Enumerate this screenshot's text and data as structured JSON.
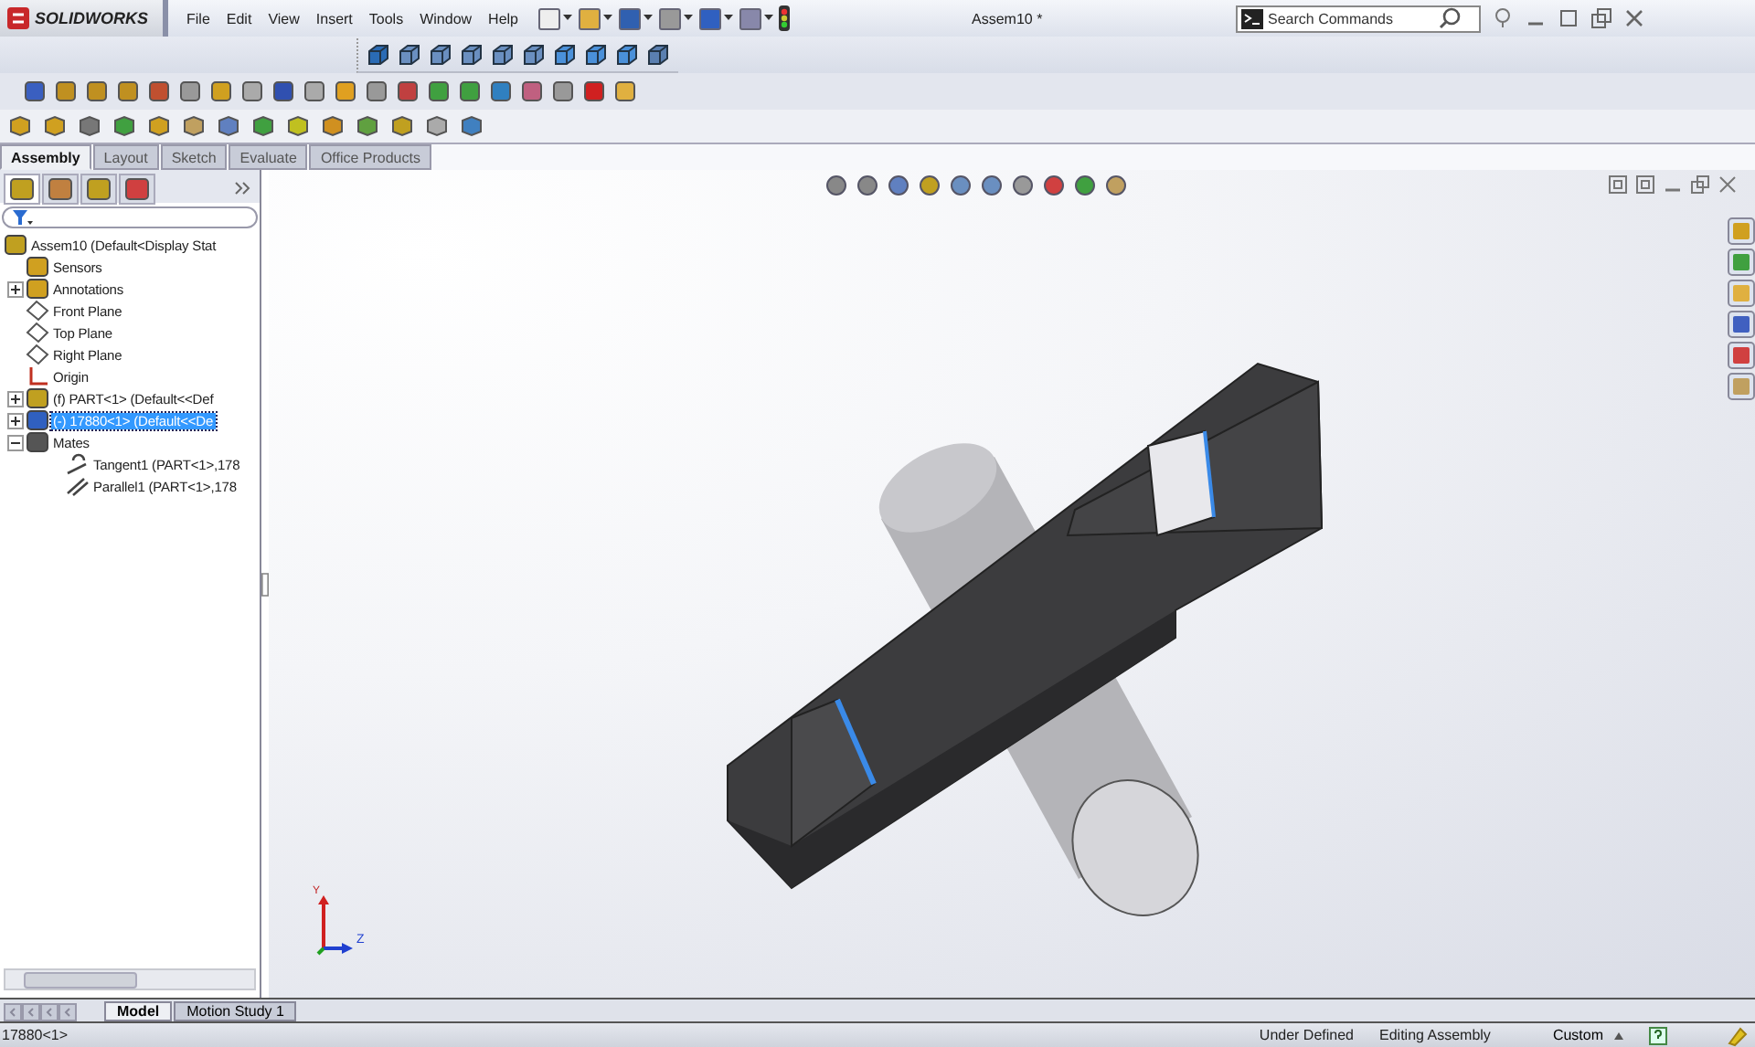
{
  "window": {
    "logo": "SOLIDWORKS",
    "title": "Assem10 *",
    "menus": [
      "File",
      "Edit",
      "View",
      "Insert",
      "Tools",
      "Window",
      "Help"
    ],
    "search": {
      "placeholder": "Search Commands"
    }
  },
  "command_tabs": [
    {
      "label": "Assembly",
      "selected": true
    },
    {
      "label": "Layout",
      "selected": false
    },
    {
      "label": "Sketch",
      "selected": false
    },
    {
      "label": "Evaluate",
      "selected": false
    },
    {
      "label": "Office Products",
      "selected": false
    }
  ],
  "feature_tree": {
    "root": {
      "label": "Assem10  (Default<Display Stat",
      "kind": "assembly",
      "selected": false,
      "children": [
        {
          "label": "Sensors",
          "kind": "sensor",
          "selected": false
        },
        {
          "label": "Annotations",
          "kind": "annotation",
          "selected": false,
          "expanded": false
        },
        {
          "label": "Front Plane",
          "kind": "plane",
          "selected": false
        },
        {
          "label": "Top Plane",
          "kind": "plane",
          "selected": false
        },
        {
          "label": "Right Plane",
          "kind": "plane",
          "selected": false
        },
        {
          "label": "Origin",
          "kind": "origin",
          "selected": false
        },
        {
          "label": "(f) PART<1> (Default<<Def",
          "kind": "part",
          "selected": false,
          "expanded": false
        },
        {
          "label": "(-) 17880<1> (Default<<De",
          "kind": "part-blue",
          "selected": true,
          "expanded": false
        },
        {
          "label": "Mates",
          "kind": "mates",
          "selected": false,
          "expanded": true,
          "children": [
            {
              "label": "Tangent1 (PART<1>,178",
              "kind": "mate-tangent",
              "selected": false
            },
            {
              "label": "Parallel1 (PART<1>,178",
              "kind": "mate-parallel",
              "selected": false
            }
          ]
        }
      ]
    }
  },
  "triad": {
    "labels": [
      "Y",
      "Z"
    ]
  },
  "bottom_tabs": [
    {
      "label": "Model",
      "selected": true
    },
    {
      "label": "Motion Study 1",
      "selected": false
    }
  ],
  "status_bar": {
    "selection": "17880<1>",
    "items": [
      "Under Defined",
      "Editing Assembly"
    ],
    "units": "Custom"
  }
}
